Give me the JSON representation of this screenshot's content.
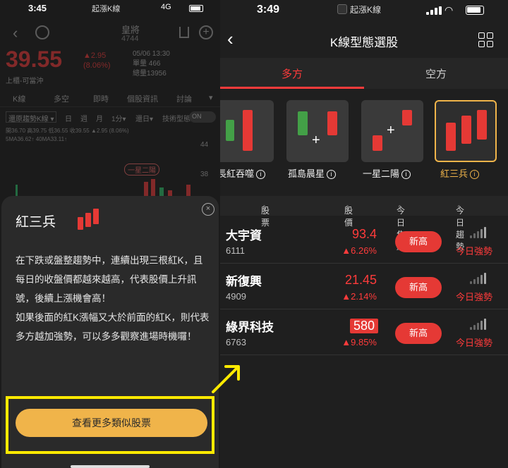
{
  "left": {
    "status": {
      "time": "3:45",
      "app": "起漲K線",
      "network": "4G"
    },
    "stock": {
      "name": "皇將",
      "code": "4744",
      "price": "39.55",
      "change": "▲2.95",
      "change_pct": "(8.06%)",
      "limit_label": "上櫃-可當沖",
      "date": "05/06 13:30",
      "volume_label": "單量",
      "volume_value": "466",
      "total_label": "總量",
      "total_value": "13956"
    },
    "tabs": [
      "K線",
      "多空",
      "即時",
      "個股資訊",
      "討論"
    ],
    "toolbar": {
      "trend_btn": "還原趨勢K線 ▾",
      "periods": [
        "日",
        "週",
        "月",
        "1分▾",
        "還日▾"
      ],
      "tech_label": "技術型態",
      "toggle": "ON"
    },
    "ohlc": "開36.70 高39.75 低36.55 收39.55 ▲2.95 (8.06%)",
    "ma": "5MA36.62↑  40MA33.11↑",
    "chart": {
      "y_top": "44",
      "y_mid": "38",
      "tag": "一星二陽"
    },
    "sheet": {
      "title": "紅三兵",
      "close": "×",
      "desc_1": "在下跌或盤整趨勢中，連續出現三根紅K，且每日的收盤價都越來越高，代表股價上升訊號，後續上漲機會高！",
      "desc_2": "如果後面的紅K漲幅又大於前面的紅K，則代表多方越加強勢，可以多多觀察進場時機囉！",
      "button": "查看更多類似股票"
    }
  },
  "right": {
    "status": {
      "time": "3:49",
      "app": "起漲K線"
    },
    "title": "K線型態選股",
    "tabs": [
      {
        "label": "多方"
      },
      {
        "label": "空方"
      }
    ],
    "patterns": [
      {
        "label": "長紅吞噬"
      },
      {
        "label": "孤島晨星"
      },
      {
        "label": "一星二陽"
      },
      {
        "label": "紅三兵"
      }
    ],
    "columns": {
      "stock": "股票",
      "price": "股價",
      "focus": "今日焦點",
      "trend": "今日趨勢"
    },
    "rows": [
      {
        "name": "大宇資",
        "code": "6111",
        "price": "93.4",
        "pct": "▲6.26%",
        "badge": "新高",
        "trend": "今日強勢"
      },
      {
        "name": "新復興",
        "code": "4909",
        "price": "21.45",
        "pct": "▲2.14%",
        "badge": "新高",
        "trend": "今日強勢"
      },
      {
        "name": "綠界科技",
        "code": "6763",
        "price": "580",
        "pct": "▲9.85%",
        "badge": "新高",
        "trend": "今日強勢"
      }
    ]
  },
  "colors": {
    "up": "#ff3b3b",
    "accent": "#f0b44a",
    "highlight": "#ffea00"
  }
}
